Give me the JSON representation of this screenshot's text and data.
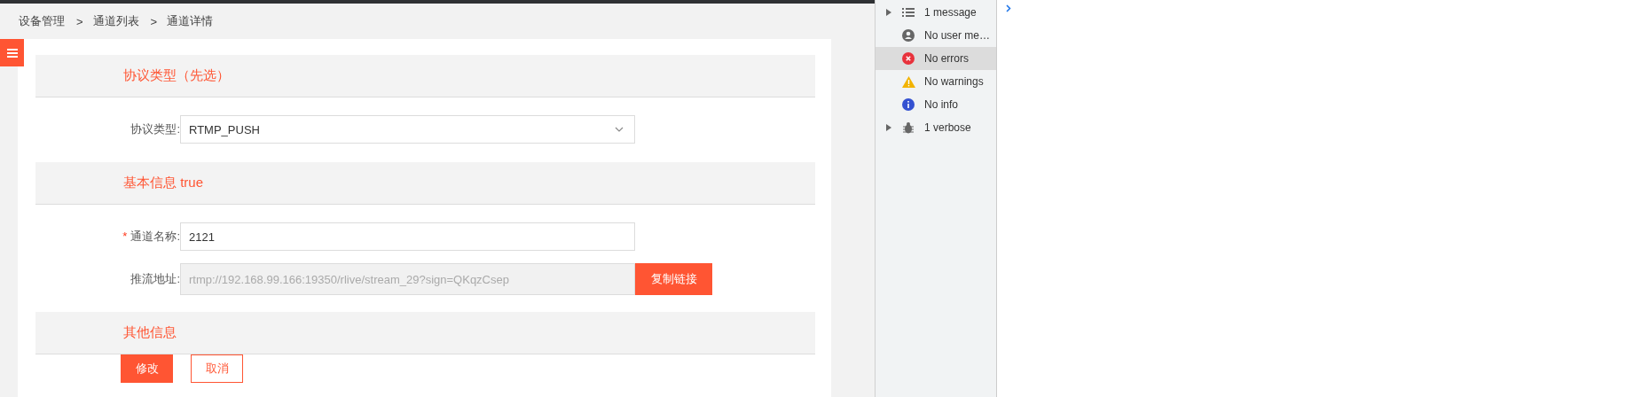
{
  "breadcrumb": {
    "separator": ">",
    "items": [
      "设备管理",
      "通道列表",
      "通道详情"
    ]
  },
  "sections": [
    {
      "title": "协议类型（先选）",
      "fields": [
        {
          "kind": "select",
          "label": "协议类型:",
          "value": "RTMP_PUSH"
        }
      ]
    },
    {
      "title": "基本信息 true",
      "fields": [
        {
          "kind": "text",
          "required_mark": "*",
          "label": "通道名称:",
          "value": "2121"
        },
        {
          "kind": "readonly",
          "label": "推流地址:",
          "value": "rtmp://192.168.99.166:19350/rlive/stream_29?sign=QKqzCsep",
          "button": "复制链接"
        }
      ]
    },
    {
      "title": "其他信息"
    }
  ],
  "actions": [
    {
      "kind": "primary",
      "label": "修改"
    },
    {
      "kind": "outline",
      "label": "取消"
    }
  ],
  "devtools_sidebar": [
    {
      "kind": "list",
      "label": "1 message",
      "expandable": true,
      "selected": false
    },
    {
      "kind": "user",
      "label": "No user me…",
      "expandable": false,
      "selected": false
    },
    {
      "kind": "error",
      "label": "No errors",
      "expandable": false,
      "selected": true
    },
    {
      "kind": "warning",
      "label": "No warnings",
      "expandable": false,
      "selected": false
    },
    {
      "kind": "info",
      "label": "No info",
      "expandable": false,
      "selected": false
    },
    {
      "kind": "bug",
      "label": "1 verbose",
      "expandable": true,
      "selected": false
    }
  ]
}
